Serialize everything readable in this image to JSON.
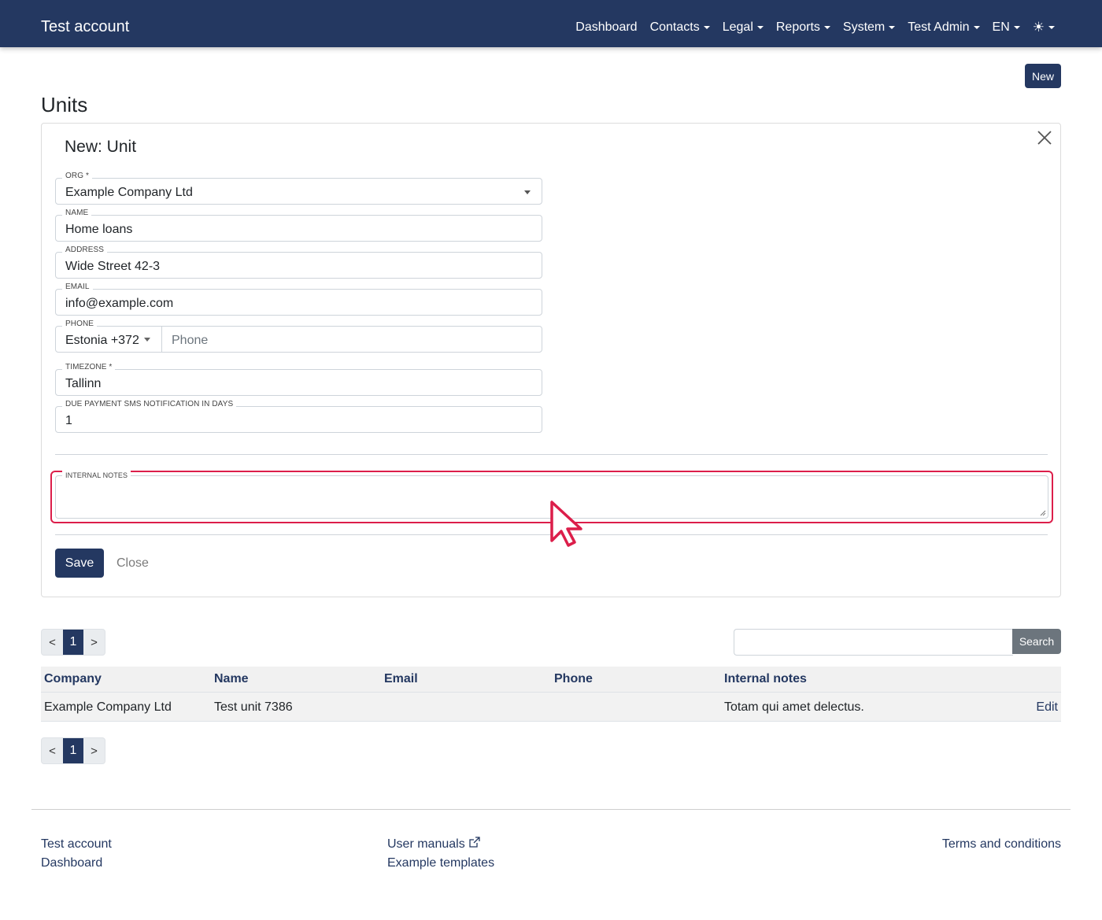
{
  "navbar": {
    "brand": "Test account",
    "items": [
      {
        "label": "Dashboard",
        "dropdown": false
      },
      {
        "label": "Contacts",
        "dropdown": true
      },
      {
        "label": "Legal",
        "dropdown": true
      },
      {
        "label": "Reports",
        "dropdown": true
      },
      {
        "label": "System",
        "dropdown": true
      },
      {
        "label": "Test Admin",
        "dropdown": true
      },
      {
        "label": "EN",
        "dropdown": true
      }
    ],
    "theme_icon": "☀",
    "color": "#243861"
  },
  "toolbar": {
    "new_label": "New"
  },
  "page": {
    "title": "Units"
  },
  "form": {
    "title": "New: Unit",
    "org": {
      "label": "ORG *",
      "value": "Example Company Ltd"
    },
    "name": {
      "label": "NAME",
      "value": "Home loans"
    },
    "address": {
      "label": "ADDRESS",
      "value": "Wide Street 42-3"
    },
    "email": {
      "label": "EMAIL",
      "value": "info@example.com"
    },
    "phone": {
      "label": "PHONE",
      "country": "Estonia +372",
      "placeholder": "Phone"
    },
    "timezone": {
      "label": "TIMEZONE *",
      "value": "Tallinn"
    },
    "sms_days": {
      "label": "DUE PAYMENT SMS NOTIFICATION IN DAYS",
      "value": "1"
    },
    "notes": {
      "label": "INTERNAL NOTES",
      "value": ""
    },
    "save_label": "Save",
    "close_label": "Close",
    "highlight_color": "#dc1e4a"
  },
  "pagination": {
    "prev": "<",
    "current": "1",
    "next": ">"
  },
  "search": {
    "button_label": "Search",
    "value": ""
  },
  "table": {
    "headers": [
      "Company",
      "Name",
      "Email",
      "Phone",
      "Internal notes"
    ],
    "rows": [
      {
        "company": "Example Company Ltd",
        "name": "Test unit 7386",
        "email": "",
        "phone": "",
        "notes": "Totam qui amet delectus.",
        "action": "Edit"
      }
    ]
  },
  "footer": {
    "col1": [
      "Test account",
      "Dashboard"
    ],
    "col2": [
      "User manuals",
      "Example templates"
    ],
    "col3": [
      "Terms and conditions"
    ]
  }
}
